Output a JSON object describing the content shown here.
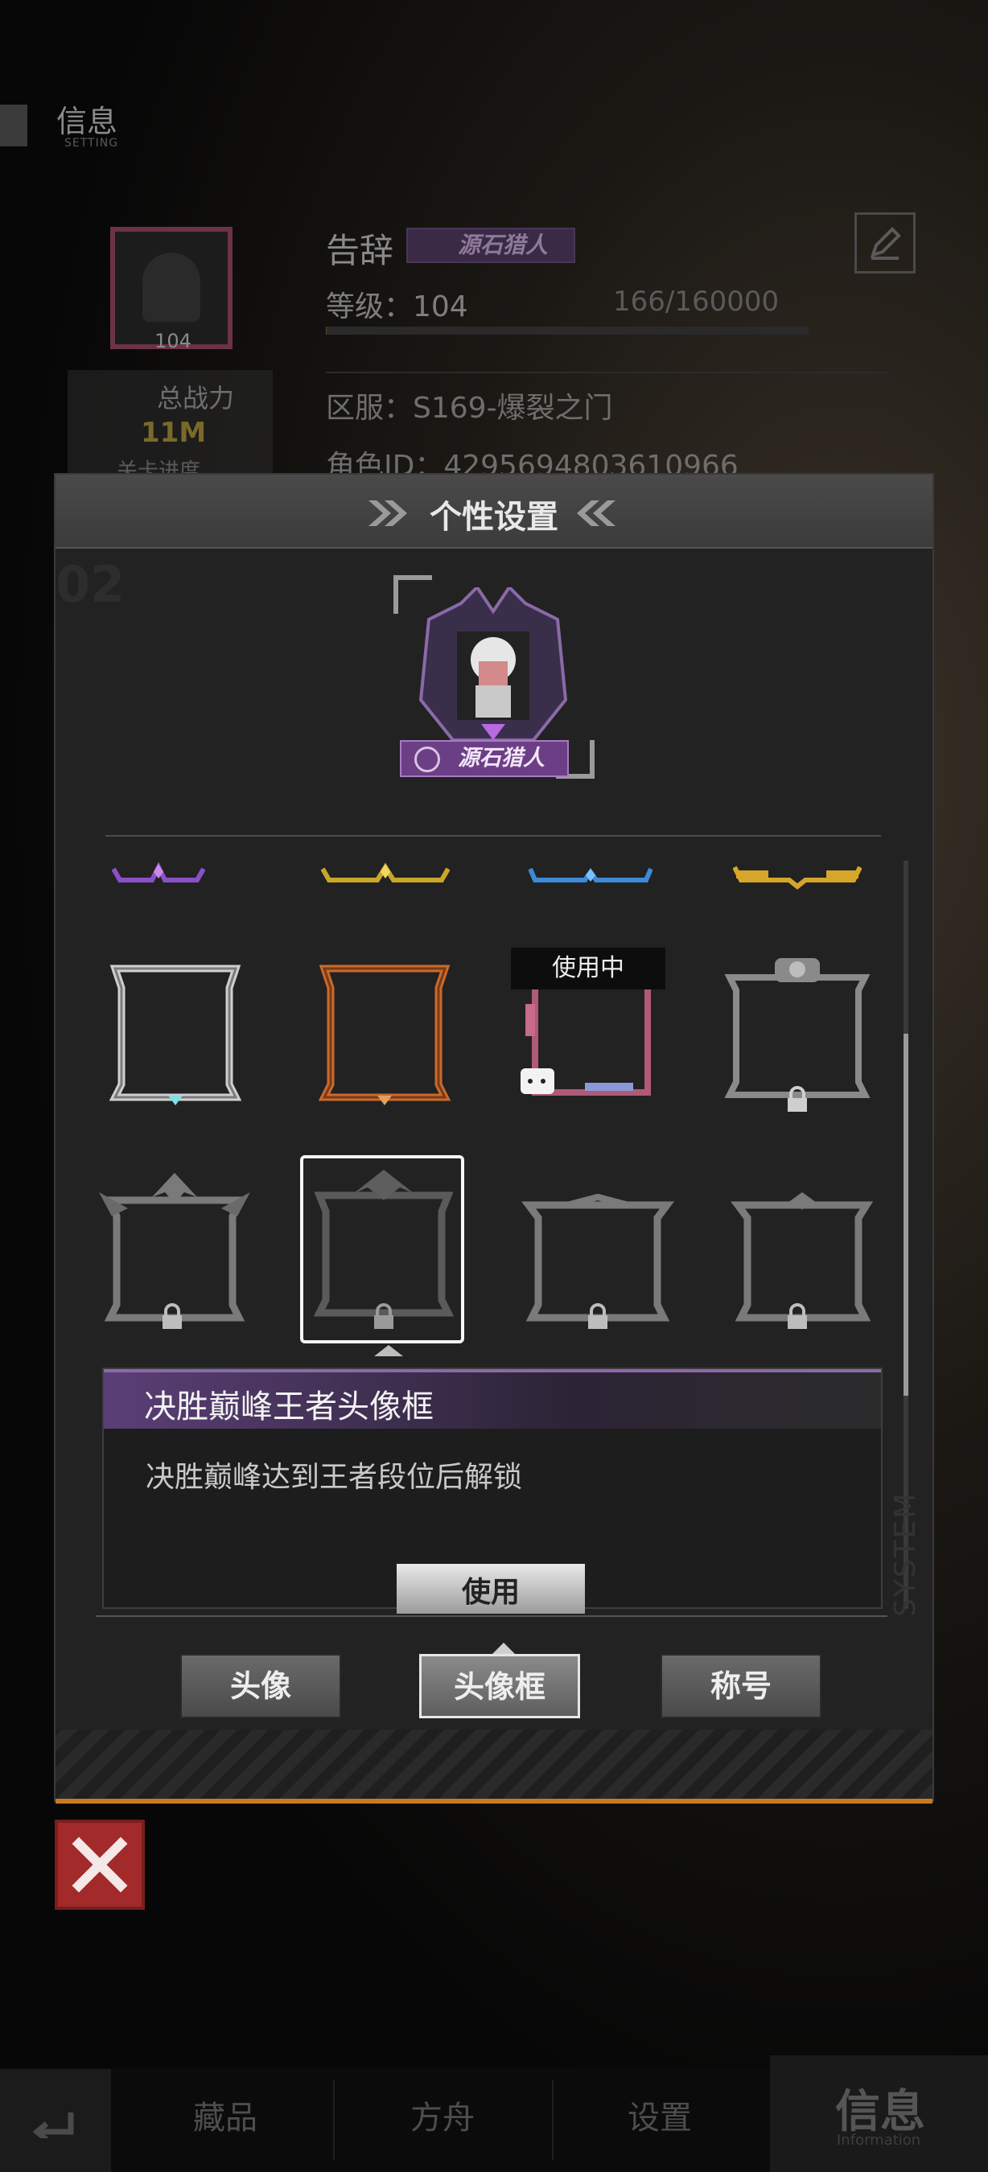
{
  "background": {
    "page_title": "信息",
    "page_subtitle": "SETTING",
    "player_name": "告辞",
    "title_badge": "源石猎人",
    "level_label": "等级：104",
    "exp_text": "166/160000",
    "exp_progress": 0.001,
    "avatar_level": "104",
    "power_label": "总战力",
    "power_value": "11M",
    "progress_label": "关卡进度",
    "server": "区服：S169-爆裂之门",
    "role_id": "角色ID：4295694803610966"
  },
  "modal": {
    "title": "个性设置",
    "side_number": "02",
    "preview_badge": "源石猎人",
    "in_use_label": "使用中",
    "selected_item": {
      "name": "决胜巅峰王者头像框",
      "description": "决胜巅峰达到王者段位后解锁",
      "use_label": "使用"
    },
    "tabs": [
      {
        "label": "头像",
        "active": false
      },
      {
        "label": "头像框",
        "active": true
      },
      {
        "label": "称号",
        "active": false
      }
    ],
    "frames_row0": [
      "purple-tiara",
      "gold-tiara",
      "blue-tiara",
      "gold-wing-tiara"
    ],
    "frames_row1": [
      {
        "name": "silver-frame",
        "locked": false
      },
      {
        "name": "bronze-frame",
        "locked": false
      },
      {
        "name": "pink-pixel-frame",
        "locked": false,
        "in_use": true
      },
      {
        "name": "mech-frame",
        "locked": true
      }
    ],
    "frames_row2": [
      {
        "name": "dragon-frame",
        "locked": true
      },
      {
        "name": "king-frame",
        "locked": true,
        "selected": true
      },
      {
        "name": "spike-frame",
        "locked": true
      },
      {
        "name": "wing-frame",
        "locked": true
      }
    ],
    "system_label": "SYSTEM",
    "accent_color": "#c87a22"
  },
  "bottom_nav": {
    "items": [
      "藏品",
      "方舟",
      "设置"
    ],
    "active": "信息",
    "active_sub": "Information"
  }
}
